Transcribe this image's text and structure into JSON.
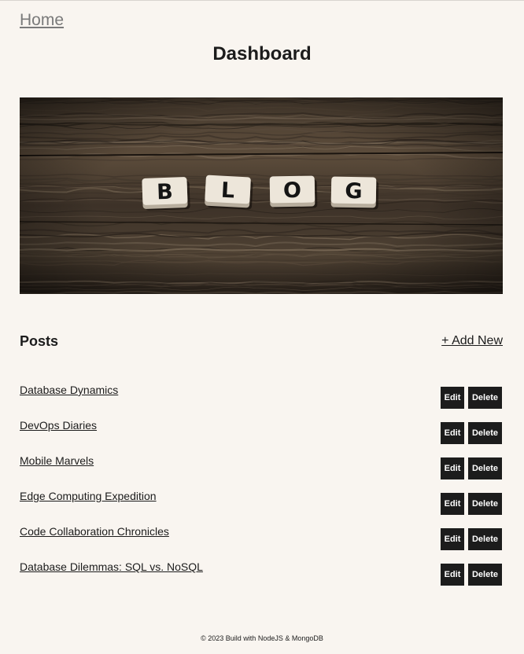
{
  "nav": {
    "home_label": "Home"
  },
  "header": {
    "title": "Dashboard"
  },
  "hero": {
    "letters": [
      "B",
      "L",
      "O",
      "G"
    ],
    "wood_colors": [
      "#3b3128",
      "#5a4b3c",
      "#2a221b",
      "#7a6a57"
    ],
    "tile_color": "#ede6da"
  },
  "posts": {
    "title": "Posts",
    "add_new_label": "+ Add New",
    "edit_label": "Edit",
    "delete_label": "Delete",
    "items": [
      {
        "title": "Database Dynamics"
      },
      {
        "title": "DevOps Diaries"
      },
      {
        "title": "Mobile Marvels"
      },
      {
        "title": "Edge Computing Expedition"
      },
      {
        "title": "Code Collaboration Chronicles"
      },
      {
        "title": "Database Dilemmas: SQL vs. NoSQL"
      }
    ]
  },
  "footer": {
    "text": "© 2023 Build with NodeJS & MongoDB"
  },
  "colors": {
    "background": "#f9f5f0",
    "text": "#1c1c1c",
    "button": "#1c1c1c",
    "home_link": "#7a7a7a"
  }
}
